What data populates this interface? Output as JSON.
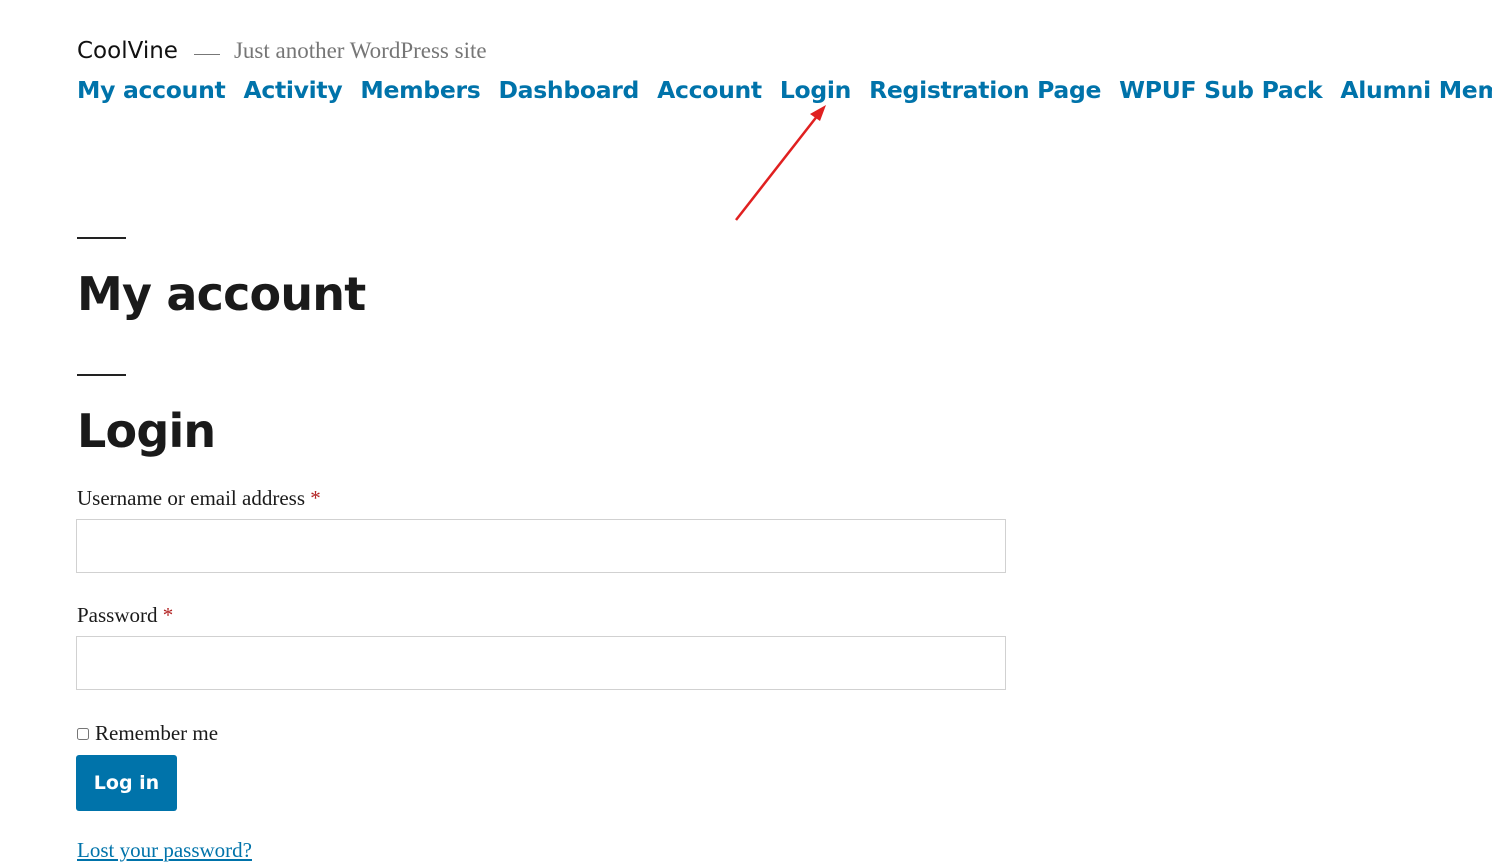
{
  "site": {
    "title": "CoolVine",
    "tagline": "Just another WordPress site"
  },
  "nav": {
    "items": [
      "My account",
      "Activity",
      "Members",
      "Dashboard",
      "Account",
      "Login",
      "Registration Page",
      "WPUF Sub Pack",
      "Alumni Members"
    ]
  },
  "annotation": {
    "arrow_color": "#e02020"
  },
  "page": {
    "title": "My account",
    "section_title": "Login"
  },
  "form": {
    "username_label": "Username or email address",
    "username_value": "",
    "password_label": "Password",
    "password_value": "",
    "required_marker": "*",
    "remember_label": "Remember me",
    "remember_checked": false,
    "submit_label": "Log in",
    "lost_password_link": "Lost your password?"
  },
  "colors": {
    "link": "#0073aa",
    "button_bg": "#0073aa",
    "required": "#b22222"
  }
}
